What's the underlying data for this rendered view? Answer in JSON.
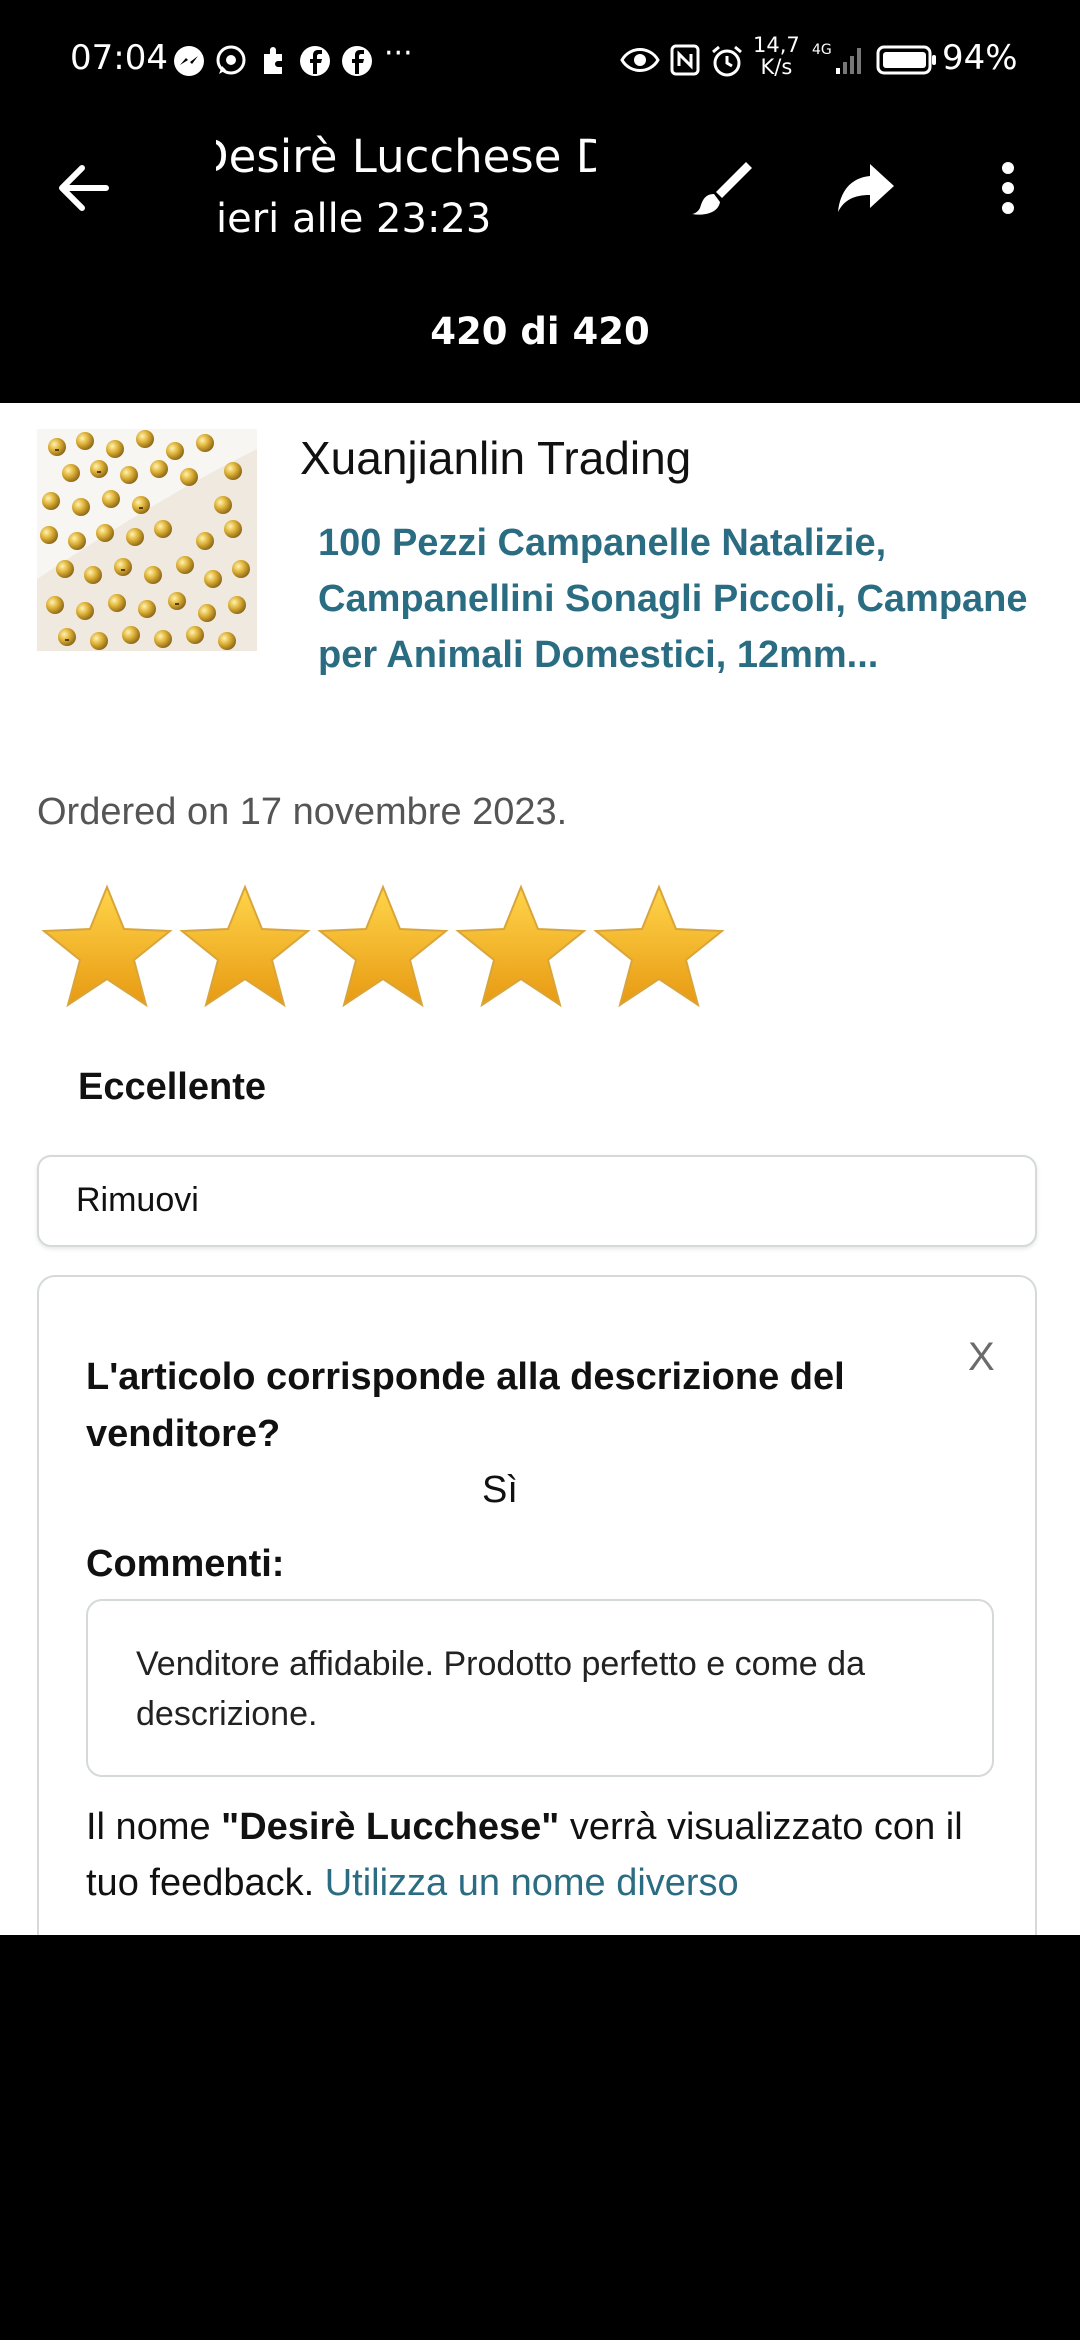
{
  "status_bar": {
    "time": "07:04",
    "net_speed_value": "14,7",
    "net_speed_unit": "K/s",
    "network": "4G",
    "battery": "94%",
    "overflow": "···"
  },
  "app_bar": {
    "title": "Desirè Lucchese   De",
    "subtitle": "ieri alle 23:23",
    "counter": "420 di 420"
  },
  "content": {
    "seller": "Xuanjianlin Trading",
    "product_title": "100 Pezzi Campanelle Natalizie, Campanellini Sonagli Piccoli, Campane per Animali Domestici, 12mm...",
    "ordered": "Ordered on 17 novembre 2023.",
    "rating_stars": 5,
    "rating_max": 5,
    "rating_label": "Eccellente",
    "remove_label": "Rimuovi",
    "feedback_card": {
      "close": "X",
      "question": "L'articolo corrisponde alla descrizione del venditore?",
      "answer": "Sì",
      "comments_label": "Commenti:",
      "comment_text": "Venditore affidabile. Prodotto perfetto e come da descrizione.",
      "name_note_prefix": "Il nome ",
      "name_note_name": "\"Desirè Lucchese\"",
      "name_note_suffix": " verrà visualizzato con il tuo feedback. ",
      "name_note_link": "Utilizza un nome diverso"
    }
  },
  "colors": {
    "link": "#2a6c82",
    "star": "#f2b01e",
    "background_dark": "#000000"
  }
}
